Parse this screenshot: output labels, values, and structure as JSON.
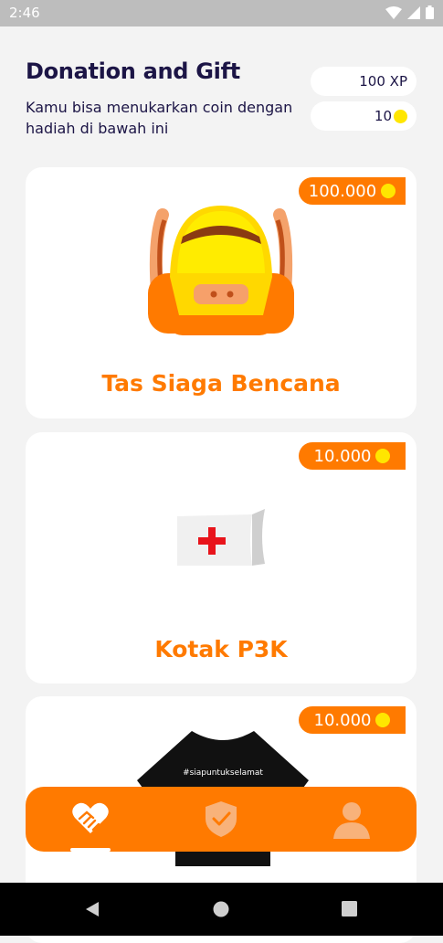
{
  "status_bar": {
    "time": "2:46"
  },
  "header": {
    "title": "Donation and Gift",
    "subtitle": "Kamu bisa menukarkan coin dengan hadiah di bawah ini",
    "xp": "100 XP",
    "coins": "10"
  },
  "items": [
    {
      "name": "Tas Siaga Bencana",
      "price": "100.000",
      "icon": "backpack-icon"
    },
    {
      "name": "Kotak P3K",
      "price": "10.000",
      "icon": "first-aid-kit-icon"
    },
    {
      "name": "",
      "price": "10.000",
      "icon": "tshirt-icon",
      "shirt_text": "#siapuntukselamat"
    }
  ],
  "bottom_nav": [
    {
      "name": "donation",
      "icon": "handshake-heart-icon",
      "active": true
    },
    {
      "name": "safety",
      "icon": "shield-check-icon",
      "active": false
    },
    {
      "name": "profile",
      "icon": "user-icon",
      "active": false
    }
  ],
  "colors": {
    "accent": "#ff7a00",
    "title": "#1c1546",
    "coin": "#ffe600",
    "background": "#f3f3f3"
  }
}
